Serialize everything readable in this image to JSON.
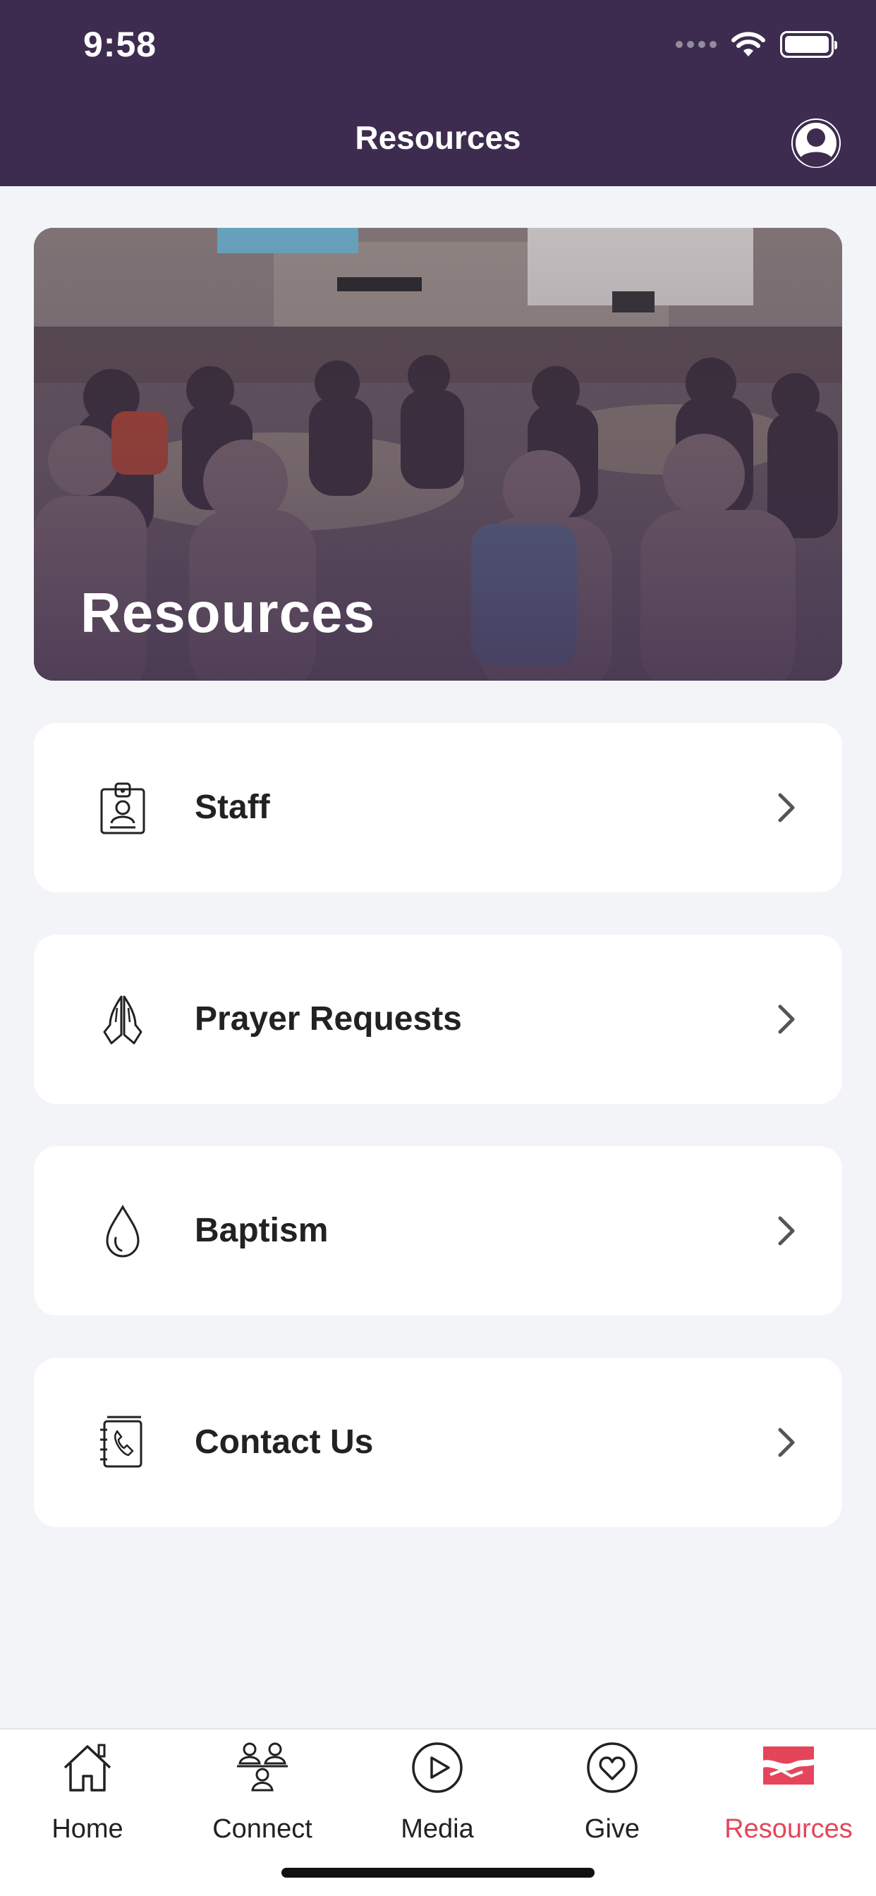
{
  "status_bar": {
    "time": "9:58"
  },
  "header": {
    "title": "Resources",
    "profile_icon": "user-circle-icon"
  },
  "hero": {
    "title": "Resources"
  },
  "menu": [
    {
      "label": "Staff",
      "icon": "staff-badge-icon"
    },
    {
      "label": "Prayer Requests",
      "icon": "praying-hands-icon"
    },
    {
      "label": "Baptism",
      "icon": "water-drop-icon"
    },
    {
      "label": "Contact Us",
      "icon": "phone-book-icon"
    }
  ],
  "tabbar": {
    "tabs": [
      {
        "label": "Home",
        "icon": "house-icon",
        "active": false
      },
      {
        "label": "Connect",
        "icon": "group-icon",
        "active": false
      },
      {
        "label": "Media",
        "icon": "play-circle-icon",
        "active": false
      },
      {
        "label": "Give",
        "icon": "heart-circle-icon",
        "active": false
      },
      {
        "label": "Resources",
        "icon": "resources-logo-icon",
        "active": true
      }
    ]
  },
  "colors": {
    "header_bg": "#3d2c4f",
    "accent": "#e5455a",
    "page_bg": "#f3f4f8",
    "card_bg": "#ffffff"
  }
}
